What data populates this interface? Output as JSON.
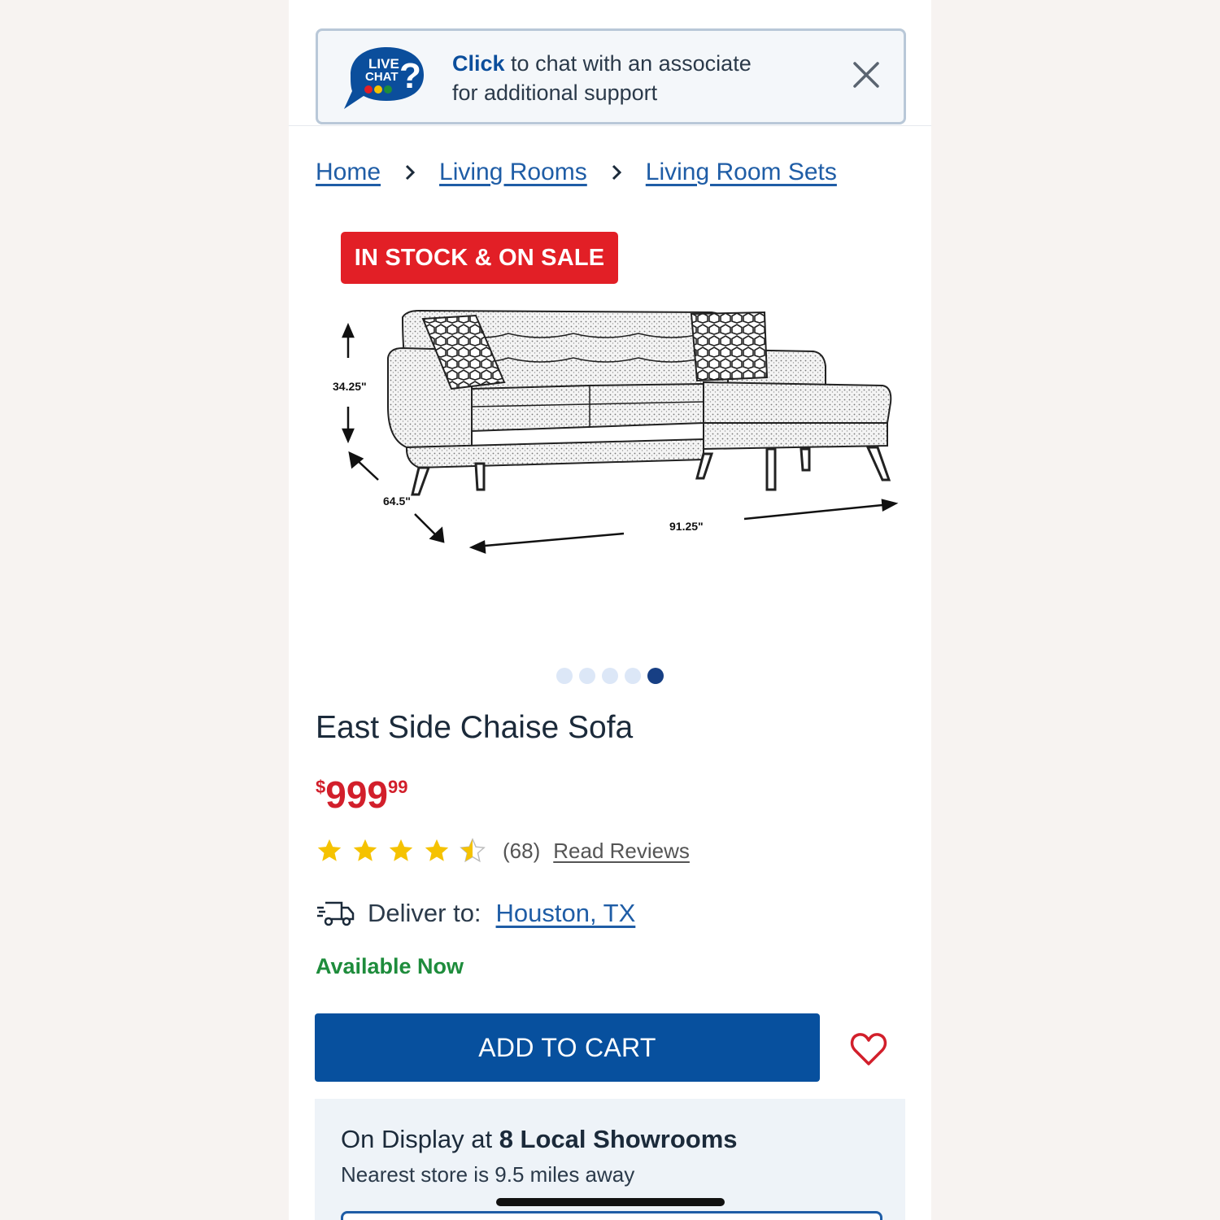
{
  "chat": {
    "logo_line1": "LIVE",
    "logo_line2": "CHAT",
    "click": "Click",
    "text1": " to chat with an associate",
    "text2": "for additional support"
  },
  "breadcrumb": {
    "items": [
      "Home",
      "Living Rooms",
      "Living Room Sets"
    ]
  },
  "badge": "IN STOCK & ON SALE",
  "image": {
    "height_label": "34.25\"",
    "depth_label": "64.5\"",
    "width_label": "91.25\""
  },
  "carousel": {
    "count": 5,
    "active_index": 4
  },
  "product": {
    "title": "East Side Chaise Sofa",
    "price_currency": "$",
    "price_main": "999",
    "price_cents": "99",
    "rating": 4.5,
    "review_count": "(68)",
    "read_reviews": "Read Reviews"
  },
  "delivery": {
    "label": "Deliver to:",
    "city": "Houston, TX",
    "availability": "Available Now"
  },
  "actions": {
    "add_to_cart": "ADD TO CART"
  },
  "showroom": {
    "prefix": "On Display at ",
    "highlight": "8 Local Showrooms",
    "nearest": "Nearest store is 9.5 miles away"
  },
  "colors": {
    "brand_blue": "#07509e",
    "sale_red": "#e21f26",
    "available_green": "#1e8c3c",
    "star_gold": "#f5c200"
  }
}
